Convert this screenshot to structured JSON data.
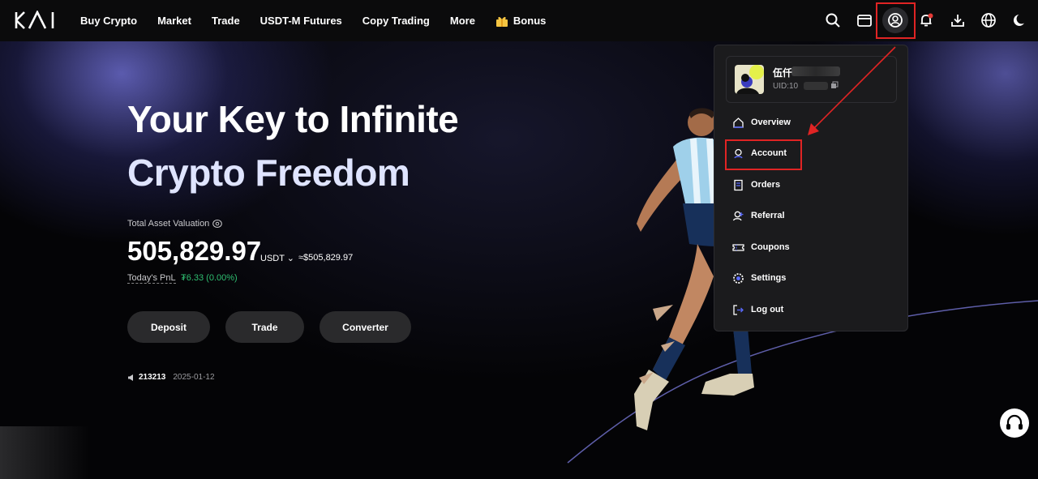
{
  "nav": {
    "logo": "KAI",
    "items": [
      "Buy Crypto",
      "Market",
      "Trade",
      "USDT-M Futures",
      "Copy Trading",
      "More"
    ],
    "bonus": "Bonus"
  },
  "top_icons": [
    "search-icon",
    "wallet-icon",
    "user-icon",
    "bell-icon",
    "download-icon",
    "globe-icon",
    "moon-icon"
  ],
  "hero": {
    "line1": "Your Key to Infinite",
    "line2": "Crypto Freedom",
    "tav_label": "Total Asset Valuation",
    "balance": "505,829.97",
    "unit": "USDT ⌄",
    "approx": "≈$505,829.97",
    "pnl_label": "Today's PnL",
    "pnl_value": "₮6.33 (0.00%)",
    "buttons": {
      "deposit": "Deposit",
      "trade": "Trade",
      "converter": "Converter"
    },
    "news_num": "213213",
    "news_date": "2025-01-12"
  },
  "dropdown": {
    "user_name": "伍仟",
    "uid": "UID:10",
    "items": {
      "overview": "Overview",
      "account": "Account",
      "orders": "Orders",
      "referral": "Referral",
      "coupons": "Coupons",
      "settings": "Settings",
      "logout": "Log out"
    }
  },
  "colors": {
    "highlight": "#e02424",
    "pnl": "#2fbf71",
    "background": "#000000"
  }
}
